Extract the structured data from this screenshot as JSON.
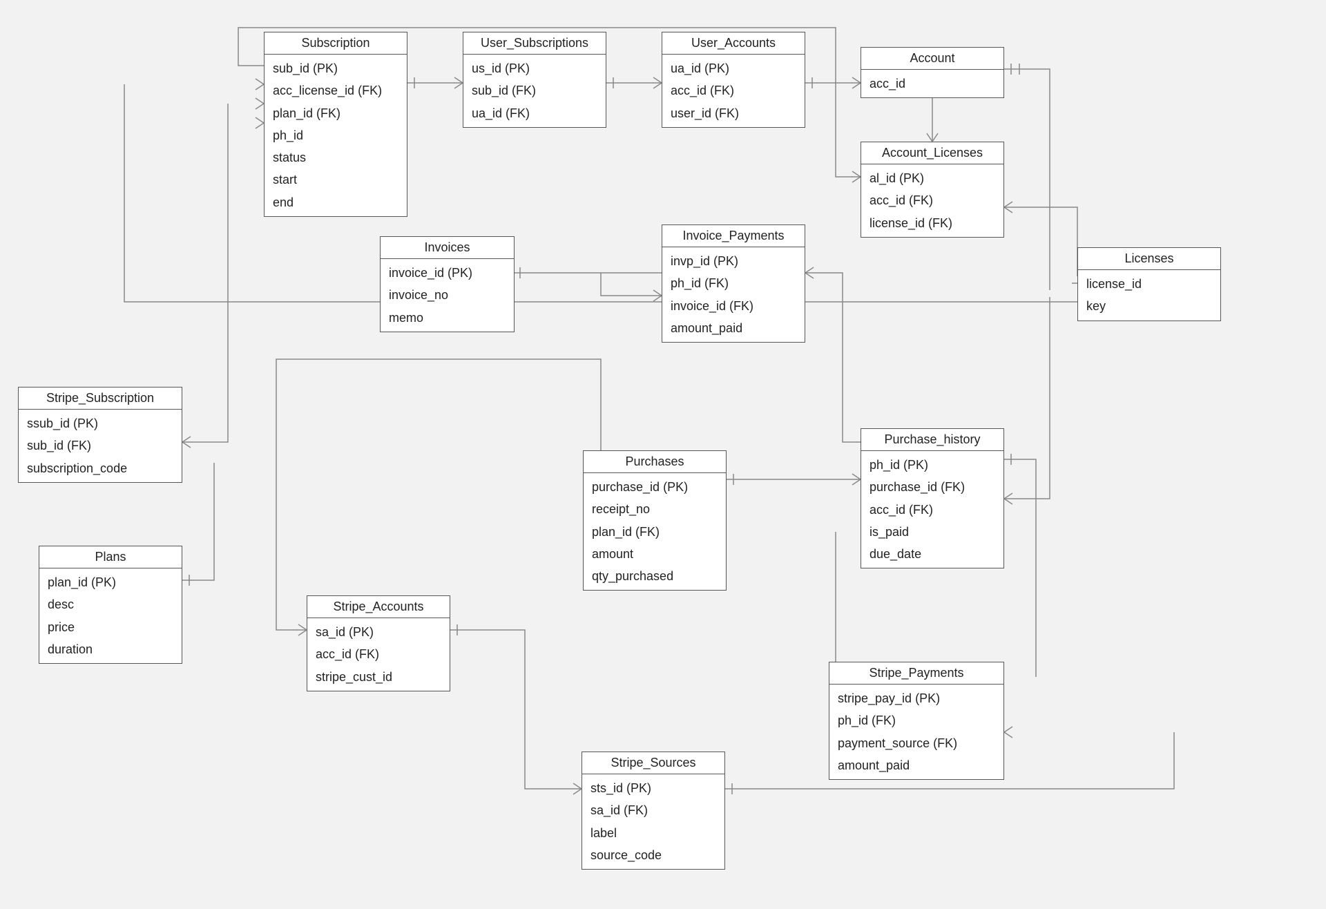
{
  "diagram_type": "entity-relationship",
  "entities": {
    "subscription": {
      "title": "Subscription",
      "fields": [
        "sub_id (PK)",
        "acc_license_id (FK)",
        "plan_id (FK)",
        "ph_id",
        "status",
        "start",
        "end"
      ]
    },
    "user_subscriptions": {
      "title": "User_Subscriptions",
      "fields": [
        "us_id (PK)",
        "sub_id (FK)",
        "ua_id (FK)"
      ]
    },
    "user_accounts": {
      "title": "User_Accounts",
      "fields": [
        "ua_id (PK)",
        "acc_id (FK)",
        "user_id (FK)"
      ]
    },
    "account": {
      "title": "Account",
      "fields": [
        "acc_id"
      ]
    },
    "account_licenses": {
      "title": "Account_Licenses",
      "fields": [
        "al_id (PK)",
        "acc_id (FK)",
        "license_id (FK)"
      ]
    },
    "licenses": {
      "title": "Licenses",
      "fields": [
        "license_id",
        "key"
      ]
    },
    "invoices": {
      "title": "Invoices",
      "fields": [
        "invoice_id (PK)",
        "invoice_no",
        "memo"
      ]
    },
    "invoice_payments": {
      "title": "Invoice_Payments",
      "fields": [
        "invp_id (PK)",
        "ph_id (FK)",
        "invoice_id (FK)",
        "amount_paid"
      ]
    },
    "stripe_subscription": {
      "title": "Stripe_Subscription",
      "fields": [
        "ssub_id (PK)",
        "sub_id (FK)",
        "subscription_code"
      ]
    },
    "plans": {
      "title": "Plans",
      "fields": [
        "plan_id (PK)",
        "desc",
        "price",
        "duration"
      ]
    },
    "purchases": {
      "title": "Purchases",
      "fields": [
        "purchase_id (PK)",
        "receipt_no",
        "plan_id (FK)",
        "amount",
        "qty_purchased"
      ]
    },
    "purchase_history": {
      "title": "Purchase_history",
      "fields": [
        "ph_id (PK)",
        "purchase_id (FK)",
        "acc_id (FK)",
        "is_paid",
        "due_date"
      ]
    },
    "stripe_accounts": {
      "title": "Stripe_Accounts",
      "fields": [
        "sa_id (PK)",
        "acc_id (FK)",
        "stripe_cust_id"
      ]
    },
    "stripe_payments": {
      "title": "Stripe_Payments",
      "fields": [
        "stripe_pay_id (PK)",
        "ph_id (FK)",
        "payment_source (FK)",
        "amount_paid"
      ]
    },
    "stripe_sources": {
      "title": "Stripe_Sources",
      "fields": [
        "sts_id (PK)",
        "sa_id (FK)",
        "label",
        "source_code"
      ]
    }
  }
}
